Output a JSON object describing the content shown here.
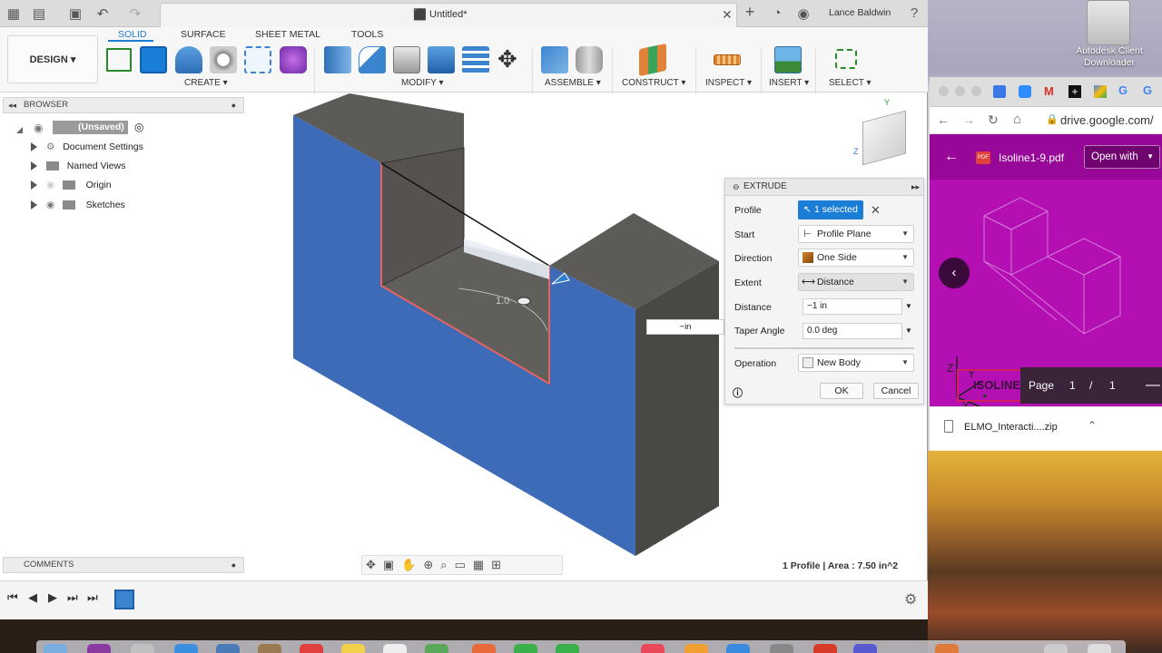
{
  "titlebar": {
    "doc_title": "Untitled*",
    "user_name": "Lance Baldwin"
  },
  "toolbar": {
    "design_label": "DESIGN ▾",
    "tabs": [
      "SOLID",
      "SURFACE",
      "SHEET METAL",
      "TOOLS"
    ],
    "groups": {
      "create": "CREATE ▾",
      "modify": "MODIFY ▾",
      "assemble": "ASSEMBLE ▾",
      "construct": "CONSTRUCT ▾",
      "inspect": "INSPECT ▾",
      "insert": "INSERT ▾",
      "select": "SELECT ▾"
    }
  },
  "browser": {
    "header": "BROWSER",
    "root": "(Unsaved)",
    "items": [
      "Document Settings",
      "Named Views",
      "Origin",
      "Sketches"
    ]
  },
  "comments": {
    "header": "COMMENTS"
  },
  "canvas": {
    "dimension_label": "1.0",
    "input_hint": "−in"
  },
  "extrude": {
    "title": "EXTRUDE",
    "profile_label": "Profile",
    "profile_value": "1 selected",
    "start_label": "Start",
    "start_value": "Profile Plane",
    "direction_label": "Direction",
    "direction_value": "One Side",
    "extent_label": "Extent",
    "extent_value": "Distance",
    "distance_label": "Distance",
    "distance_value": "−1 in",
    "taper_label": "Taper Angle",
    "taper_value": "0.0 deg",
    "operation_label": "Operation",
    "operation_value": "New Body",
    "ok_label": "OK",
    "cancel_label": "Cancel"
  },
  "status": {
    "text": "1 Profile | Area : 7.50 in^2"
  },
  "desktop": {
    "drive_label": "Autodesk Client Downloader"
  },
  "chrome": {
    "url": "drive.google.com/",
    "pdf_name": "Isoline1-9.pdf",
    "open_with": "Open with",
    "page_label": "Page",
    "page_current": "1",
    "page_sep": "/",
    "page_total": "1",
    "pdf_banner": "ISOLINE",
    "download_file": "ELMO_Interacti....zip"
  },
  "colors": {
    "accent": "#1b7ed6",
    "model_blue": "#3d6bb8",
    "model_gray": "#5c5a57",
    "pdf_magenta": "#b30fb3"
  }
}
